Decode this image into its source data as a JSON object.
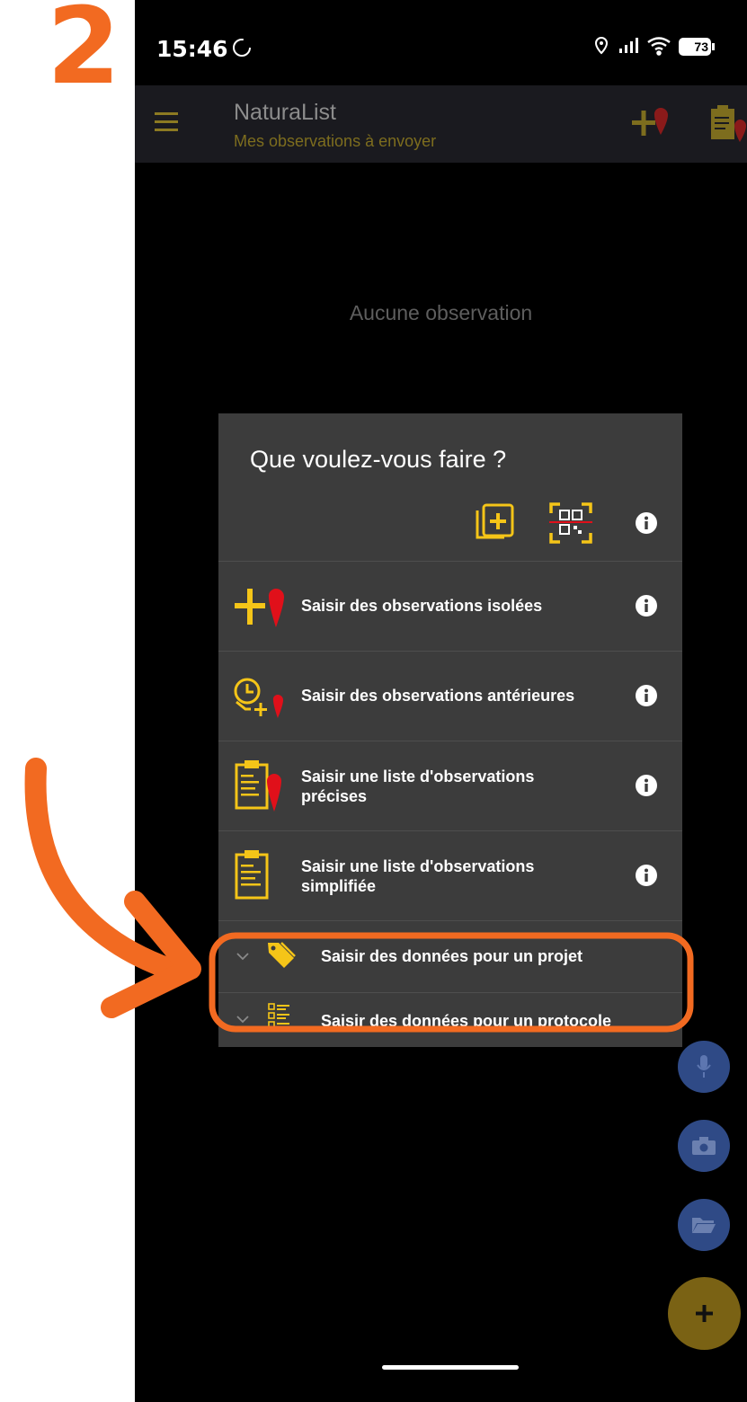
{
  "step_number": "2",
  "status": {
    "time": "15:46",
    "battery": "73"
  },
  "app": {
    "title": "NaturaList",
    "subtitle": "Mes observations à envoyer"
  },
  "empty_state": "Aucune observation",
  "dialog": {
    "title": "Que voulez-vous faire ?",
    "options": [
      {
        "label": "Saisir des observations isolées"
      },
      {
        "label": "Saisir des observations antérieures"
      },
      {
        "label_line1": "Saisir une liste d'observations",
        "label_line2": "précises"
      },
      {
        "label_line1": "Saisir une liste d'observations",
        "label_line2": "simplifiée"
      }
    ],
    "groups": [
      {
        "label": "Saisir des données pour un projet"
      },
      {
        "label": "Saisir des données pour un protocole"
      }
    ]
  },
  "colors": {
    "accent": "#f26a21",
    "icon_yellow": "#f5c518",
    "marker_red": "#e0101a",
    "fab_blue": "#2f4a86",
    "fab_gold": "#7a6214"
  }
}
